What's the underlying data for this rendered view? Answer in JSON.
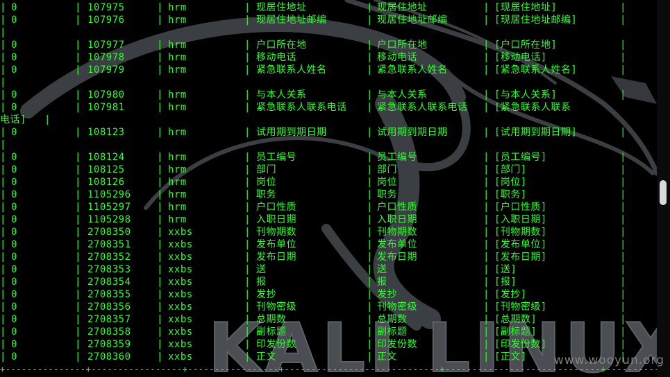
{
  "background": {
    "wallpaper_text": "KALI LINUX",
    "dragon_color": "#3b3f44",
    "terminal_text_color": "#2cff2c"
  },
  "watermark": "www.wooyun.org",
  "rows": [
    {
      "a": "0",
      "b": "107975",
      "c": "hrm",
      "d": "现居住地址",
      "e": "现居住地址",
      "f": "[现居住地址]"
    },
    {
      "a": "0",
      "b": "107976",
      "c": "hrm",
      "d": "现居住地址邮编",
      "e": "现居住地址邮编",
      "f": "[现居住地址邮编]"
    },
    {
      "a": "",
      "b": "",
      "c": "",
      "d": "",
      "e": "",
      "f": ""
    },
    {
      "a": "0",
      "b": "107977",
      "c": "hrm",
      "d": "户口所在地",
      "e": "户口所在地",
      "f": "[户口所在地]"
    },
    {
      "a": "0",
      "b": "107978",
      "c": "hrm",
      "d": "移动电话",
      "e": "移动电话",
      "f": "[移动电话]"
    },
    {
      "a": "0",
      "b": "107979",
      "c": "hrm",
      "d": "紧急联系人姓名",
      "e": "紧急联系人姓名",
      "f": "[紧急联系人姓名]"
    },
    {
      "a": "",
      "b": "",
      "c": "",
      "d": "",
      "e": "",
      "f": ""
    },
    {
      "a": "0",
      "b": "107980",
      "c": "hrm",
      "d": "与本人关系",
      "e": "与本人关系",
      "f": "[与本人关系]"
    },
    {
      "a": "0",
      "b": "107981",
      "c": "hrm",
      "d": "紧急联系人联系电话",
      "e": "紧急联系人联系电话",
      "f": "[紧急联系人联系"
    },
    {
      "a": "电话]",
      "b": "",
      "c": "",
      "d": "",
      "e": "",
      "f": ""
    },
    {
      "a": "0",
      "b": "108123",
      "c": "hrm",
      "d": "试用期到期日期",
      "e": "试用期到期日期",
      "f": "[试用期到期日期]"
    },
    {
      "a": "",
      "b": "",
      "c": "",
      "d": "",
      "e": "",
      "f": ""
    },
    {
      "a": "0",
      "b": "108124",
      "c": "hrm",
      "d": "员工编号",
      "e": "员工编号",
      "f": "[员工编号]"
    },
    {
      "a": "0",
      "b": "108125",
      "c": "hrm",
      "d": "部门",
      "e": "部门",
      "f": "[部门]"
    },
    {
      "a": "0",
      "b": "108126",
      "c": "hrm",
      "d": "岗位",
      "e": "岗位",
      "f": "[岗位]"
    },
    {
      "a": "0",
      "b": "1105296",
      "c": "hrm",
      "d": "职务",
      "e": "职务",
      "f": "[职务]"
    },
    {
      "a": "0",
      "b": "1105297",
      "c": "hrm",
      "d": "户口性质",
      "e": "户口性质",
      "f": "[户口性质]"
    },
    {
      "a": "0",
      "b": "1105298",
      "c": "hrm",
      "d": "入职日期",
      "e": "入职日期",
      "f": "[入职日期]"
    },
    {
      "a": "0",
      "b": "2708350",
      "c": "xxbs",
      "d": "刊物期数",
      "e": "刊物期数",
      "f": "[刊物期数]"
    },
    {
      "a": "0",
      "b": "2708351",
      "c": "xxbs",
      "d": "发布单位",
      "e": "发布单位",
      "f": "[发布单位]"
    },
    {
      "a": "0",
      "b": "2708352",
      "c": "xxbs",
      "d": "发布日期",
      "e": "发布日期",
      "f": "[发布日期]"
    },
    {
      "a": "0",
      "b": "2708353",
      "c": "xxbs",
      "d": "送",
      "e": "送",
      "f": "[送]"
    },
    {
      "a": "0",
      "b": "2708354",
      "c": "xxbs",
      "d": "报",
      "e": "报",
      "f": "[报]"
    },
    {
      "a": "0",
      "b": "2708355",
      "c": "xxbs",
      "d": "发抄",
      "e": "发抄",
      "f": "[发抄]"
    },
    {
      "a": "0",
      "b": "2708356",
      "c": "xxbs",
      "d": "刊物密级",
      "e": "刊物密级",
      "f": "[刊物密级]"
    },
    {
      "a": "0",
      "b": "2708357",
      "c": "xxbs",
      "d": "总期数",
      "e": "总期数",
      "f": "[总期数]"
    },
    {
      "a": "0",
      "b": "2708358",
      "c": "xxbs",
      "d": "副标题",
      "e": "副标题",
      "f": "[副标题]"
    },
    {
      "a": "0",
      "b": "2708359",
      "c": "xxbs",
      "d": "印发份数",
      "e": "印发份数",
      "f": "[印发份数]"
    },
    {
      "a": "0",
      "b": "2708360",
      "c": "xxbs",
      "d": "正文",
      "e": "正文",
      "f": "[正文]"
    }
  ],
  "separator": "+---------------+-----------------+-----------------+-----------------------------+-----------------------------+-----------------------------+"
}
